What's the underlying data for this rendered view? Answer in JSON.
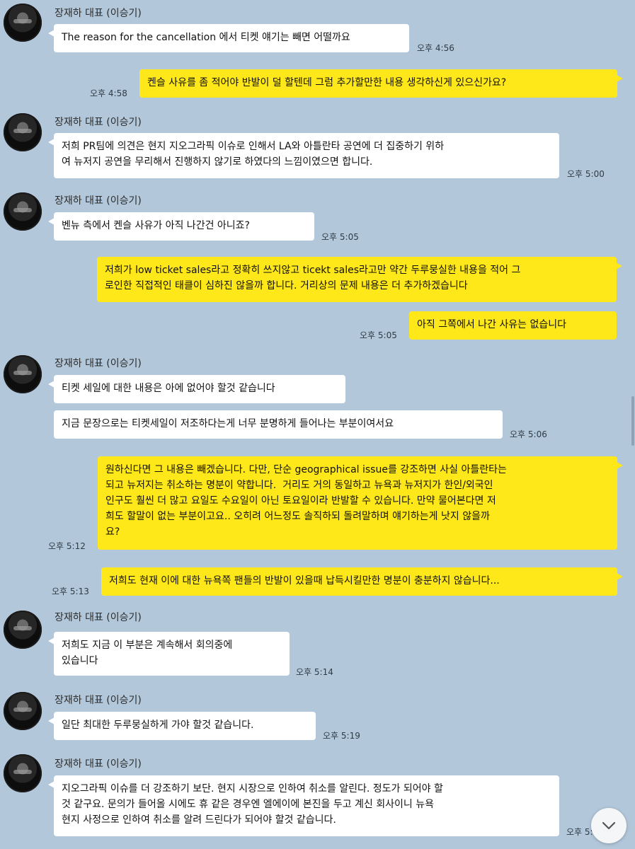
{
  "colors": {
    "background": "#b2c7da",
    "incoming_bubble": "#ffffff",
    "outgoing_bubble": "#ffe81a"
  },
  "sender_name": "장재하 대표 (이승기)",
  "messages": [
    {
      "direction": "in",
      "show_header": true,
      "text": "The reason for the cancellation 에서 티켓 얘기는 빼면 어떨까요",
      "time": "오후 4:56"
    },
    {
      "direction": "out",
      "text": "켄슬 사유를 좀 적어야 반발이 덜 할텐데 그럼 추가할만한 내용 생각하신게 있으신가요?",
      "time": "오후 4:58"
    },
    {
      "direction": "in",
      "show_header": true,
      "text": "저희 PR팀에 의견은 현지 지오그라픽 이슈로 인해서 LA와 아틀란타 공연에 더 집중하기 위하\n여 뉴저지 공연을 무리해서 진행하지 않기로 하였다의 느낌이였으면 합니다.",
      "time": "오후 5:00"
    },
    {
      "direction": "in",
      "show_header": true,
      "text": "벤뉴 측에서 켄슬 사유가 아직 나간건 아니죠?",
      "time": "오후 5:05"
    },
    {
      "direction": "out",
      "text": "저희가 low ticket sales라고 정확히 쓰지않고 ticekt sales라고만 약간 두루뭉실한 내용을 적어 그\n로인한 직접적인 태클이 심하진 않을까 합니다. 거리상의 문제 내용은 더 추가하겠습니다",
      "time": ""
    },
    {
      "direction": "out",
      "text": "아직 그쪽에서 나간 사유는 없습니다",
      "time": "오후 5:05"
    },
    {
      "direction": "in",
      "show_header": true,
      "text": "티켓 세일에 대한 내용은 아에 없어야 할것 같습니다",
      "time": ""
    },
    {
      "direction": "in",
      "text": "지금 문장으로는 티켓세일이 저조하다는게 너무 분명하게 들어나는 부분이여서요",
      "time": "오후 5:06"
    },
    {
      "direction": "out",
      "text": "원하신다면 그 내용은 빼겠습니다. 다만, 단순 geographical issue를 강조하면 사실 아틀란타는\n되고 뉴저지는 취소하는 명분이 약합니다.  거리도 거의 동일하고 뉴욕과 뉴저지가 한인/외국인\n인구도 훨씬 더 많고 요일도 수요일이 아닌 토요일이라 반발할 수 있습니다. 만약 물어본다면 저\n희도 할말이 없는 부분이고요.. 오히려 어느정도 솔직하되 돌려말하며 얘기하는게 낫지 않을까\n요?",
      "time": "오후 5:12"
    },
    {
      "direction": "out",
      "text": "저희도 현재 이에 대한 뉴욕쪽 팬들의 반발이 있을때 납득시킬만한 명분이 충분하지 않습니다...",
      "time": "오후 5:13"
    },
    {
      "direction": "in",
      "show_header": true,
      "text": "저희도 지금 이 부분은 계속해서 회의중에\n있습니다",
      "time": "오후 5:14"
    },
    {
      "direction": "in",
      "show_header": true,
      "text": "일단 최대한 두루뭉실하게 가야 할것 같습니다.",
      "time": "오후 5:19"
    },
    {
      "direction": "in",
      "show_header": true,
      "text": "지오그라픽 이슈를 더 강조하기 보단. 현지 시장으로 인하여 취소를 알린다. 정도가 되어야 할\n것 같구요. 문의가 들어올 시에도 휴 같은 경우엔 엘에이에 본진을 두고 계신 회사이니 뉴욕\n현지 사정으로 인하여 취소를 알려 드린다가 되어야 할것 같습니다.",
      "time": "오후 5:"
    }
  ]
}
